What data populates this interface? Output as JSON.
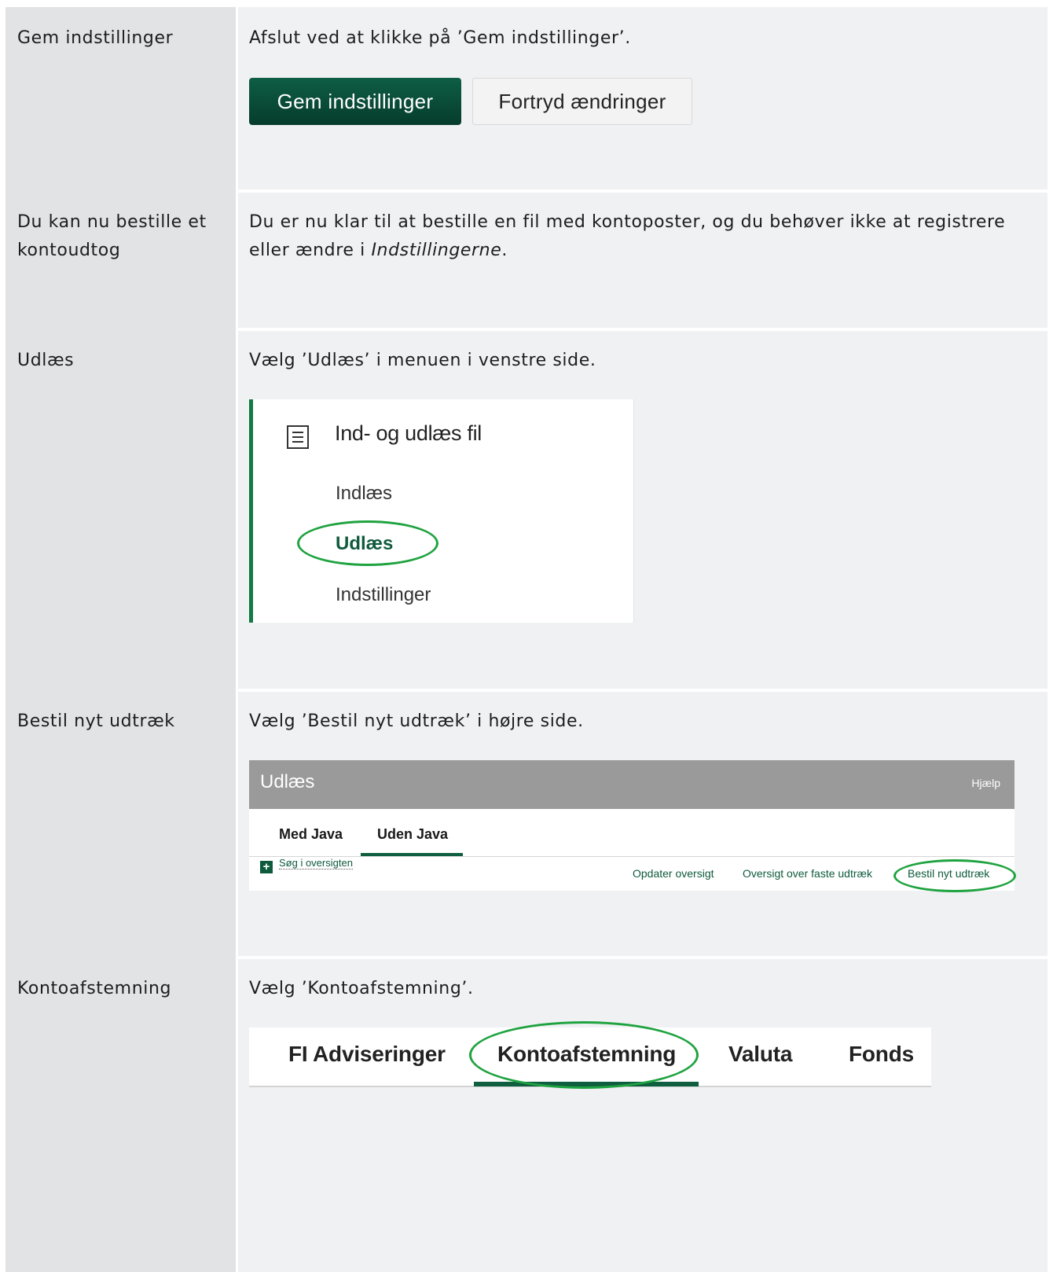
{
  "rows": [
    {
      "label": "Gem indstillinger",
      "description": "Afslut ved at klikke på ’Gem indstillinger’.",
      "buttons": {
        "save": "Gem indstillinger",
        "undo": "Fortryd ændringer"
      }
    },
    {
      "label_line1": "Du kan nu bestille et",
      "label_line2": "kontoudtog",
      "description_line1": "Du er nu klar til at bestille en fil med kontoposter, og du behøver ikke at registrere",
      "description_line2_prefix": "eller ændre i ",
      "description_line2_emphasis": "Indstillingerne",
      "description_line2_suffix": "."
    },
    {
      "label": "Udlæs",
      "description": "Vælg ’Udlæs’ i menuen i venstre side.",
      "menu": {
        "icon": "document-list-icon",
        "title": "Ind- og udlæs fil",
        "items": [
          "Indlæs",
          "Udlæs",
          "Indstillinger"
        ],
        "active": "Udlæs"
      }
    },
    {
      "label": "Bestil nyt udtræk",
      "description": "Vælg ’Bestil nyt udtræk’ i højre side.",
      "panel": {
        "title": "Udlæs",
        "help": "Hjælp",
        "tabs": [
          "Med Java",
          "Uden Java"
        ],
        "active_tab": "Uden Java",
        "search_link": "Søg i oversigten",
        "links": [
          "Opdater oversigt",
          "Oversigt over faste udtræk",
          "Bestil nyt udtræk"
        ]
      }
    },
    {
      "label": "Kontoafstemning",
      "description": "Vælg ’Kontoafstemning’.",
      "tabs": [
        "FI Adviseringer",
        "Kontoafstemning",
        "Valuta",
        "Fonds"
      ],
      "active_tab": "Kontoafstemning"
    }
  ],
  "colors": {
    "accent_green": "#0f5e3f",
    "highlight_circle": "#1fa340",
    "left_column": "#e1e3e5",
    "right_column": "#f0f1f3"
  }
}
